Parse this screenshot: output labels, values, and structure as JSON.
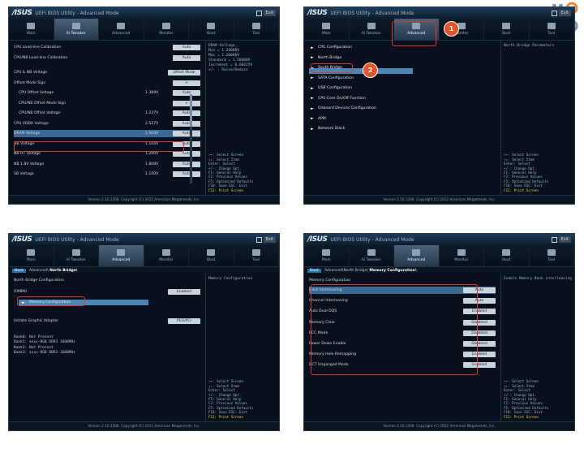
{
  "utility_title": "UEFI BIOS Utility - Advanced Mode",
  "exit_label": "Exit",
  "tabs": [
    "Main",
    "Ai Tweaker",
    "Advanced",
    "Monitor",
    "Boot",
    "Tool"
  ],
  "footer": "Version 2.10.1208. Copyright (C) 2012 American Megatrends, Inc.",
  "back_label": "Back",
  "help_keys": "→←: Select Screen\n↑↓: Select Item\nEnter: Select\n+/-: Change Opt.\nF1: General Help\nF2: Previous Values\nF5: Optimized Defaults\nF10: Save  ESC: Exit\nF12: Print Screen",
  "watermark": "MO Y",
  "s1": {
    "help_top": "DRAM Voltage\nMin = 1.20000V\nMax = 2.20000V\nStandard = 1.50000V\nIncrement = 0.00625V\n+/- : Raise/Reduce",
    "rows": [
      {
        "label": "CPU Load-line Calibration",
        "num": "",
        "value": "Auto"
      },
      {
        "label": "CPU/NB Load-line Calibration",
        "num": "",
        "value": "Auto"
      },
      {
        "label": "CPU & NB Voltage",
        "num": "",
        "value": "Offset Mode"
      },
      {
        "label": "Offset Mode Sign",
        "num": "",
        "value": "+"
      },
      {
        "label": "CPU Offset Voltage",
        "num": "1.389V",
        "value": "Auto"
      },
      {
        "label": "CPU/NB Offset Mode Sign",
        "num": "",
        "value": "+"
      },
      {
        "label": "CPU/NB Offset Voltage",
        "num": "1.237V",
        "value": "Auto"
      },
      {
        "label": "CPU VDDA Voltage",
        "num": "2.527V",
        "value": "Auto"
      },
      {
        "label": "DRAM Voltage",
        "num": "1.504V",
        "value": "Auto"
      },
      {
        "label": "NB Voltage",
        "num": "1.104V",
        "value": "Auto"
      },
      {
        "label": "NB HT Voltage",
        "num": "1.200V",
        "value": "Auto"
      },
      {
        "label": "NB 1.8V Voltage",
        "num": "1.808V",
        "value": "Auto"
      },
      {
        "label": "SB Voltage",
        "num": "1.100V",
        "value": "Auto"
      }
    ]
  },
  "s2": {
    "help_top": "North Bridge Parameters",
    "items": [
      "CPU Configuration",
      "North Bridge",
      "South Bridge",
      "SATA Configuration",
      "USB Configuration",
      "CPU Core On/Off Function",
      "Onboard Devices Configuration",
      "APM",
      "Network Stack"
    ],
    "badge1": "1",
    "badge2": "2"
  },
  "s3": {
    "crumb": "Advanced\\",
    "crumb_bold": "North Bridge\\",
    "help_top": "Memory Configuration",
    "heading": "North Bridge Configuration",
    "iommu_label": "IOMMU",
    "iommu_value": "Enabled",
    "memcfg": "Memory Configuration",
    "igfx_label": "Initiate Graphic Adapter",
    "igfx_value": "PEG/PCI",
    "info": "Bank0: Not Present\nBank1: xxxx-8GB DDR3 1600MHz\nBank2: Not Present\nBank3: xxxx-8GB DDR3 1600MHz"
  },
  "s4": {
    "crumb": "Advanced\\North Bridge\\",
    "crumb_bold": "Memory Configuration\\",
    "help_top": "Enable Memory Bank interleaving",
    "heading": "Memory Configuration",
    "rows": [
      {
        "label": "Bank Interleaving",
        "value": "Auto"
      },
      {
        "label": "Channel Interleaving",
        "value": "Auto"
      },
      {
        "label": "Auto Dual DQS",
        "value": "Enabled"
      },
      {
        "label": "Memory Clear",
        "value": "Disabled"
      },
      {
        "label": "ECC Mode",
        "value": "Disabled"
      },
      {
        "label": "Power Down Enable",
        "value": "Disabled"
      },
      {
        "label": "Memory Hole Remapping",
        "value": "Enabled"
      },
      {
        "label": "DCT Unganged Mode",
        "value": "Enabled"
      }
    ]
  }
}
